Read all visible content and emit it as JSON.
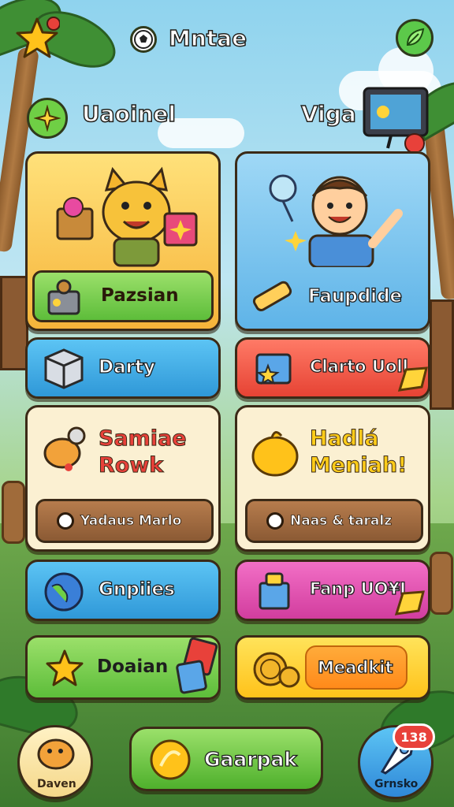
{
  "header": {
    "title": "Mntae",
    "left_section": "Uaoinel",
    "right_section": "Viga"
  },
  "cards": {
    "top_left_button": "Pazsian",
    "top_right_button": "Faupdide",
    "row2_left": "Darty",
    "row2_right": "Clarto Uoll",
    "row3_left_title": [
      "Samiae",
      "Rowk"
    ],
    "row3_left_sub": "Yadaus Marlo",
    "row3_right_title": [
      "Hadlá",
      "Meniah!"
    ],
    "row3_right_sub": "Naas & taralz",
    "row4_left": "Gnpiies",
    "row4_right": "Fanp UO¥I",
    "row5_left": "Doaian",
    "row5_right": "Meadkit"
  },
  "bottom_bar": {
    "left_label": "Daven",
    "center_label": "Gaarpak",
    "right_label": "Grnsko",
    "right_badge": "138"
  },
  "icons": {
    "top_left": "star-icon",
    "header_left": "soccer-ball-icon",
    "top_right": "leaf-icon",
    "left_section": "sparkle-icon",
    "right_section": "tablet-icon"
  },
  "colors": {
    "green": "#7bd84a",
    "blue": "#3aa9e8",
    "red": "#f05a4a",
    "cream": "#fbf0d2",
    "pink": "#ea4fb4",
    "yellow": "#ffd43a",
    "orange": "#ff9a2a"
  }
}
